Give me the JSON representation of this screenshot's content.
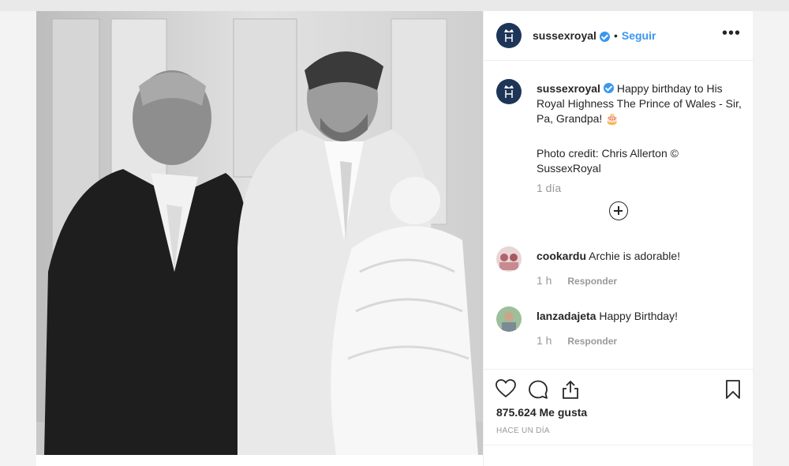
{
  "post": {
    "username": "sussexroyal",
    "separator": "•",
    "follow_label": "Seguir",
    "more_icon": "more-horizontal-icon",
    "caption": {
      "username": "sussexroyal",
      "text": "Happy birthday to His Royal Highness The Prince of Wales - Sir, Pa, Grandpa! 🎂",
      "credit": "Photo credit: Chris Allerton © SussexRoyal",
      "time": "1 día"
    },
    "load_more_icon": "plus-circle-icon",
    "comments": [
      {
        "username": "cookardu",
        "text": "Archie is adorable!",
        "time": "1 h",
        "reply_label": "Responder"
      },
      {
        "username": "lanzadajeta",
        "text": "Happy Birthday!",
        "time": "1 h",
        "reply_label": "Responder"
      }
    ],
    "actions": {
      "like_icon": "heart-icon",
      "comment_icon": "comment-bubble-icon",
      "share_icon": "share-icon",
      "save_icon": "bookmark-icon"
    },
    "likes": "875.624 Me gusta",
    "posted_ago": "HACE UN DÍA"
  },
  "colors": {
    "accent": "#3897f0",
    "text": "#262626",
    "muted": "#999999",
    "avatar_bg": "#1d3557"
  }
}
